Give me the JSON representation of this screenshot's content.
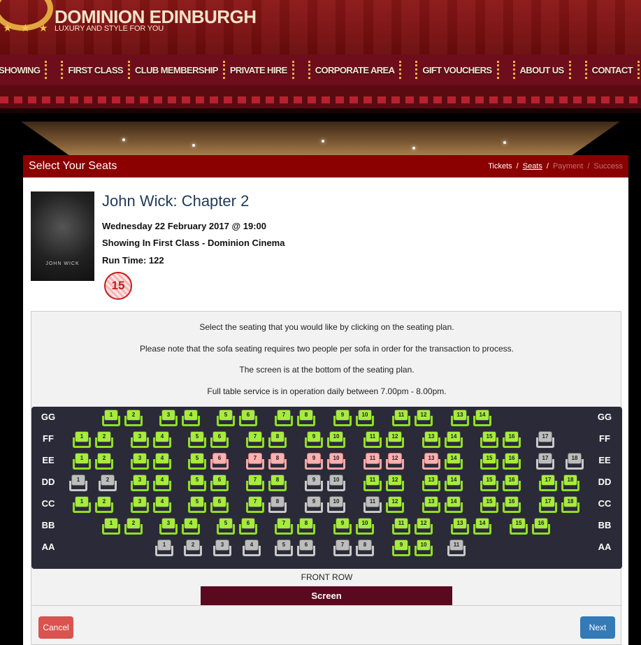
{
  "brand": {
    "name": "DOMINION EDINBURGH",
    "tagline": "LUXURY AND STYLE FOR YOU",
    "stars": "★ ★ ★"
  },
  "nav": [
    "SHOWING",
    "FIRST CLASS",
    "CLUB MEMBERSHIP",
    "PRIVATE HIRE",
    "CORPORATE AREA",
    "GIFT VOUCHERS",
    "ABOUT US",
    "CONTACT"
  ],
  "page": {
    "title": "Select Your Seats",
    "breadcrumbs": {
      "tickets": "Tickets",
      "seats": "Seats",
      "payment": "Payment",
      "success": "Success",
      "sep": "/"
    }
  },
  "movie": {
    "title": "John Wick: Chapter 2",
    "datetime": "Wednesday 22 February 2017 @ 19:00",
    "showing": "Showing In First Class - Dominion Cinema",
    "runtime": "Run Time: 122",
    "rating": "15",
    "poster_text": "JOHN WICK"
  },
  "instructions": [
    "Select the seating that you would like by clicking on the seating plan.",
    "Please note that the sofa seating requires two people per sofa in order for the transaction to process.",
    "The screen is at the bottom of the seating plan.",
    "Full table service is in operation daily between 7.00pm - 8.00pm."
  ],
  "seat_colors": {
    "available": "#a6ec3b",
    "unavailable": "#bdbdbd",
    "sold": "#ffb0b0"
  },
  "rows": [
    {
      "label": "GG",
      "seats": [
        "a",
        "a",
        "a",
        "a",
        "a",
        "a",
        "a",
        "a",
        "a",
        "a",
        "a",
        "a",
        "a",
        "a"
      ]
    },
    {
      "label": "FF",
      "seats": [
        "a",
        "a",
        "a",
        "a",
        "a",
        "a",
        "a",
        "a",
        "a",
        "a",
        "a",
        "a",
        "a",
        "a",
        "a",
        "a",
        "u"
      ]
    },
    {
      "label": "EE",
      "seats": [
        "a",
        "a",
        "a",
        "a",
        "a",
        "s",
        "s",
        "s",
        "s",
        "s",
        "s",
        "s",
        "s",
        "a",
        "a",
        "a",
        "u",
        "u"
      ]
    },
    {
      "label": "DD",
      "seats": [
        "u",
        "u",
        "a",
        "a",
        "a",
        "a",
        "a",
        "a",
        "u",
        "u",
        "a",
        "a",
        "a",
        "a",
        "a",
        "a",
        "a",
        "a"
      ]
    },
    {
      "label": "CC",
      "seats": [
        "a",
        "a",
        "a",
        "a",
        "a",
        "a",
        "a",
        "u",
        "u",
        "u",
        "u",
        "a",
        "a",
        "a",
        "a",
        "a",
        "a",
        "a"
      ]
    },
    {
      "label": "BB",
      "seats": [
        "a",
        "a",
        "a",
        "a",
        "a",
        "a",
        "a",
        "a",
        "a",
        "a",
        "a",
        "a",
        "a",
        "a",
        "a",
        "a"
      ]
    },
    {
      "label": "AA",
      "seats": [
        "u",
        "u",
        "u",
        "u",
        "u",
        "u",
        "u",
        "u",
        "a",
        "a",
        "u"
      ]
    }
  ],
  "front_row": "FRONT ROW",
  "screen": "Screen",
  "buttons": {
    "cancel": "Cancel",
    "next": "Next"
  }
}
